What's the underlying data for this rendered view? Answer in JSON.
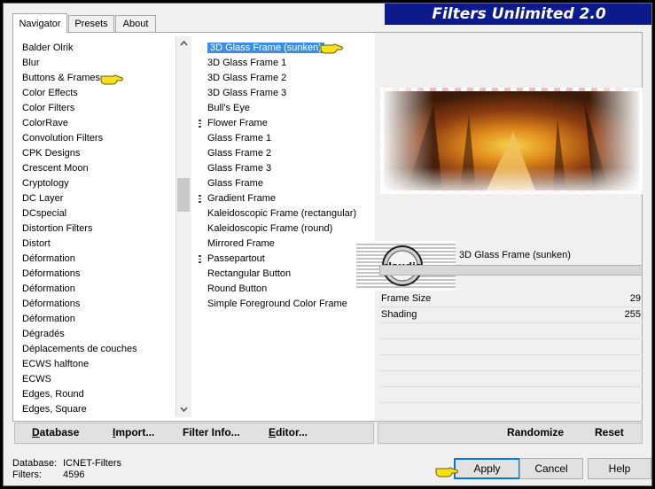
{
  "app": {
    "title": "Filters Unlimited 2.0"
  },
  "tabs": [
    {
      "label": "Navigator",
      "active": true
    },
    {
      "label": "Presets",
      "active": false
    },
    {
      "label": "About",
      "active": false
    }
  ],
  "categories": [
    "Balder Olrik",
    "Blur",
    "Buttons & Frames",
    "Color Effects",
    "Color Filters",
    "ColorRave",
    "Convolution Filters",
    "CPK Designs",
    "Crescent Moon",
    "Cryptology",
    "DC Layer",
    "DCspecial",
    "Distortion Filters",
    "Distort",
    "Déformation",
    "Déformations",
    "Déformation",
    "Déformations",
    "Déformation",
    "Dégradés",
    "Déplacements de couches",
    "ECWS halftone",
    "ECWS",
    "Edges, Round",
    "Edges, Square"
  ],
  "filters": [
    {
      "label": "3D Glass Frame (sunken)",
      "selected": true,
      "grip": false
    },
    {
      "label": "3D Glass Frame 1",
      "selected": false,
      "grip": false
    },
    {
      "label": "3D Glass Frame 2",
      "selected": false,
      "grip": false
    },
    {
      "label": "3D Glass Frame 3",
      "selected": false,
      "grip": false
    },
    {
      "label": "Bull's Eye",
      "selected": false,
      "grip": false
    },
    {
      "label": "Flower Frame",
      "selected": false,
      "grip": true
    },
    {
      "label": "Glass Frame 1",
      "selected": false,
      "grip": false
    },
    {
      "label": "Glass Frame 2",
      "selected": false,
      "grip": false
    },
    {
      "label": "Glass Frame 3",
      "selected": false,
      "grip": false
    },
    {
      "label": "Glass Frame",
      "selected": false,
      "grip": false
    },
    {
      "label": "Gradient Frame",
      "selected": false,
      "grip": true
    },
    {
      "label": "Kaleidoscopic Frame (rectangular)",
      "selected": false,
      "grip": false
    },
    {
      "label": "Kaleidoscopic Frame (round)",
      "selected": false,
      "grip": false
    },
    {
      "label": "Mirrored Frame",
      "selected": false,
      "grip": false
    },
    {
      "label": "Passepartout",
      "selected": false,
      "grip": true
    },
    {
      "label": "Rectangular Button",
      "selected": false,
      "grip": false
    },
    {
      "label": "Round Button",
      "selected": false,
      "grip": false
    },
    {
      "label": "Simple Foreground Color Frame",
      "selected": false,
      "grip": false
    }
  ],
  "selected_filter_name": "3D Glass Frame (sunken)",
  "watermark": {
    "text": "claudia"
  },
  "params": [
    {
      "label": "Frame Size",
      "value": "29"
    },
    {
      "label": "Shading",
      "value": "255"
    }
  ],
  "bottom_left_buttons": [
    {
      "label": "Database",
      "underline": "D",
      "rest": "atabase"
    },
    {
      "label": "Import...",
      "underline": "I",
      "rest": "mport..."
    },
    {
      "label": "Filter Info...",
      "underline": "",
      "rest": "Filter Info..."
    },
    {
      "label": "Editor...",
      "underline": "E",
      "rest": "ditor..."
    }
  ],
  "randomize_label": "Randomize",
  "reset_label": "Reset",
  "status": {
    "database_label": "Database:",
    "database_value": "ICNET-Filters",
    "filters_label": "Filters:",
    "filters_value": "4596"
  },
  "dialog_buttons": {
    "apply": "Apply",
    "cancel": "Cancel",
    "help": "Help"
  },
  "colors": {
    "title_bar": "#0c1a8c",
    "selection": "#3c8ee0",
    "pointer": "#f7e21a"
  },
  "icons": {
    "scroll_up": "chevron-up-icon",
    "scroll_down": "chevron-down-icon",
    "pointer": "pointing-hand-icon"
  }
}
